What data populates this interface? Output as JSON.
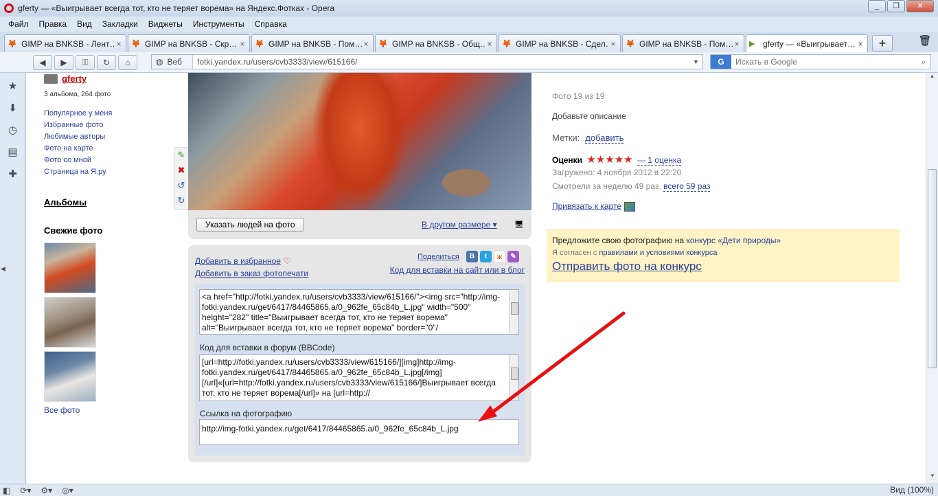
{
  "window": {
    "title": "gferty — «Выигрывает всегда тот, кто не теряет ворема» на Яндекс.Фотках - Opera",
    "minimize": "_",
    "restore": "❐",
    "close": "✕"
  },
  "menu": [
    "Файл",
    "Правка",
    "Вид",
    "Закладки",
    "Виджеты",
    "Инструменты",
    "Справка"
  ],
  "tabs": [
    {
      "label": "GIMP на BNKSB - Лент…"
    },
    {
      "label": "GIMP на BNKSB - Скр…"
    },
    {
      "label": "GIMP на BNKSB - Пом…"
    },
    {
      "label": "GIMP на BNKSB - Общ…"
    },
    {
      "label": "GIMP на BNKSB - Сдел…"
    },
    {
      "label": "GIMP на BNKSB - Пом…"
    },
    {
      "label": "gferty — «Выигрывает…"
    }
  ],
  "nav": {
    "mode_label": "Веб",
    "url": "fotki.yandex.ru/users/cvb3333/view/615166/",
    "search_placeholder": "Искать в Google",
    "search_engine": "G"
  },
  "sidebar": {
    "username": "gferty",
    "albums_count": "3 альбома, 264 фото",
    "links": [
      "Популярное у меня",
      "Избранные фото",
      "Любимые авторы",
      "Фото на карте",
      "Фото со мной",
      "Страница на Я.ру"
    ],
    "albums_heading": "Альбомы",
    "fresh_heading": "Свежие фото",
    "all_photos": "Все фото"
  },
  "photo": {
    "tag_people_button": "Указать людей на фото",
    "other_size": "В другом размере ▾"
  },
  "share": {
    "add_favorite": "Добавить в избранное",
    "add_print": "Добавить в заказ фотопечати",
    "share_label": "Поделиться",
    "social": [
      "В",
      "t",
      "ж",
      "✎"
    ],
    "embed_label": "Код для вставки на сайт или в блог",
    "html_code": "<a href=\"http://fotki.yandex.ru/users/cvb3333/view/615166/\"><img src=\"http://img-fotki.yandex.ru/get/6417/84465865.a/0_962fe_65c84b_L.jpg\" width=\"500\" height=\"282\" title=\"Выигрывает всегда тот, кто не теряет ворема\" alt=\"Выигрывает всегда тот, кто не теряет ворема\" border=\"0\"/",
    "forum_label": "Код для вставки в форум (BBCode)",
    "bbcode": "[url=http://fotki.yandex.ru/users/cvb3333/view/615166/][img]http://img-fotki.yandex.ru/get/6417/84465865.a/0_962fe_65c84b_L.jpg[/img][/url]«[url=http://fotki.yandex.ru/users/cvb3333/view/615166/]Выигрывает всегда тот, кто не теряет ворема[/url]» на [url=http://",
    "link_label": "Ссылка на фотографию",
    "link": "http://img-fotki.yandex.ru/get/6417/84465865.a/0_962fe_65c84b_L.jpg"
  },
  "info": {
    "counter": "Фото 19 из 19",
    "description": "Добавьте описание",
    "tags_label": "Метки:",
    "tags_add": "добавить",
    "ratings_label": "Оценки",
    "stars": "★★★★★",
    "ratings_count": "— 1 оценка",
    "uploaded": "Загружено:  4 ноября 2012 в 22:20",
    "views_prefix": "Смотрели за неделю 49 раз,",
    "views_link": "всего 59 раз",
    "map_link": "Привязать к карте"
  },
  "contest": {
    "offer_text": "Предложите свою фотографию на",
    "offer_link": "конкурс «Дети природы»",
    "agree_text": "Я согласен с",
    "agree_link": "правилами и условиями конкурса",
    "submit": "Отправить фото на конкурс"
  },
  "status": {
    "zoom": "Вид (100%)"
  },
  "colors": {
    "accent_link": "#2a3f9c",
    "username": "#cc0000",
    "stars": "#e02020",
    "contest_bg": "#fdf3c4",
    "arrow": "#e81010"
  }
}
